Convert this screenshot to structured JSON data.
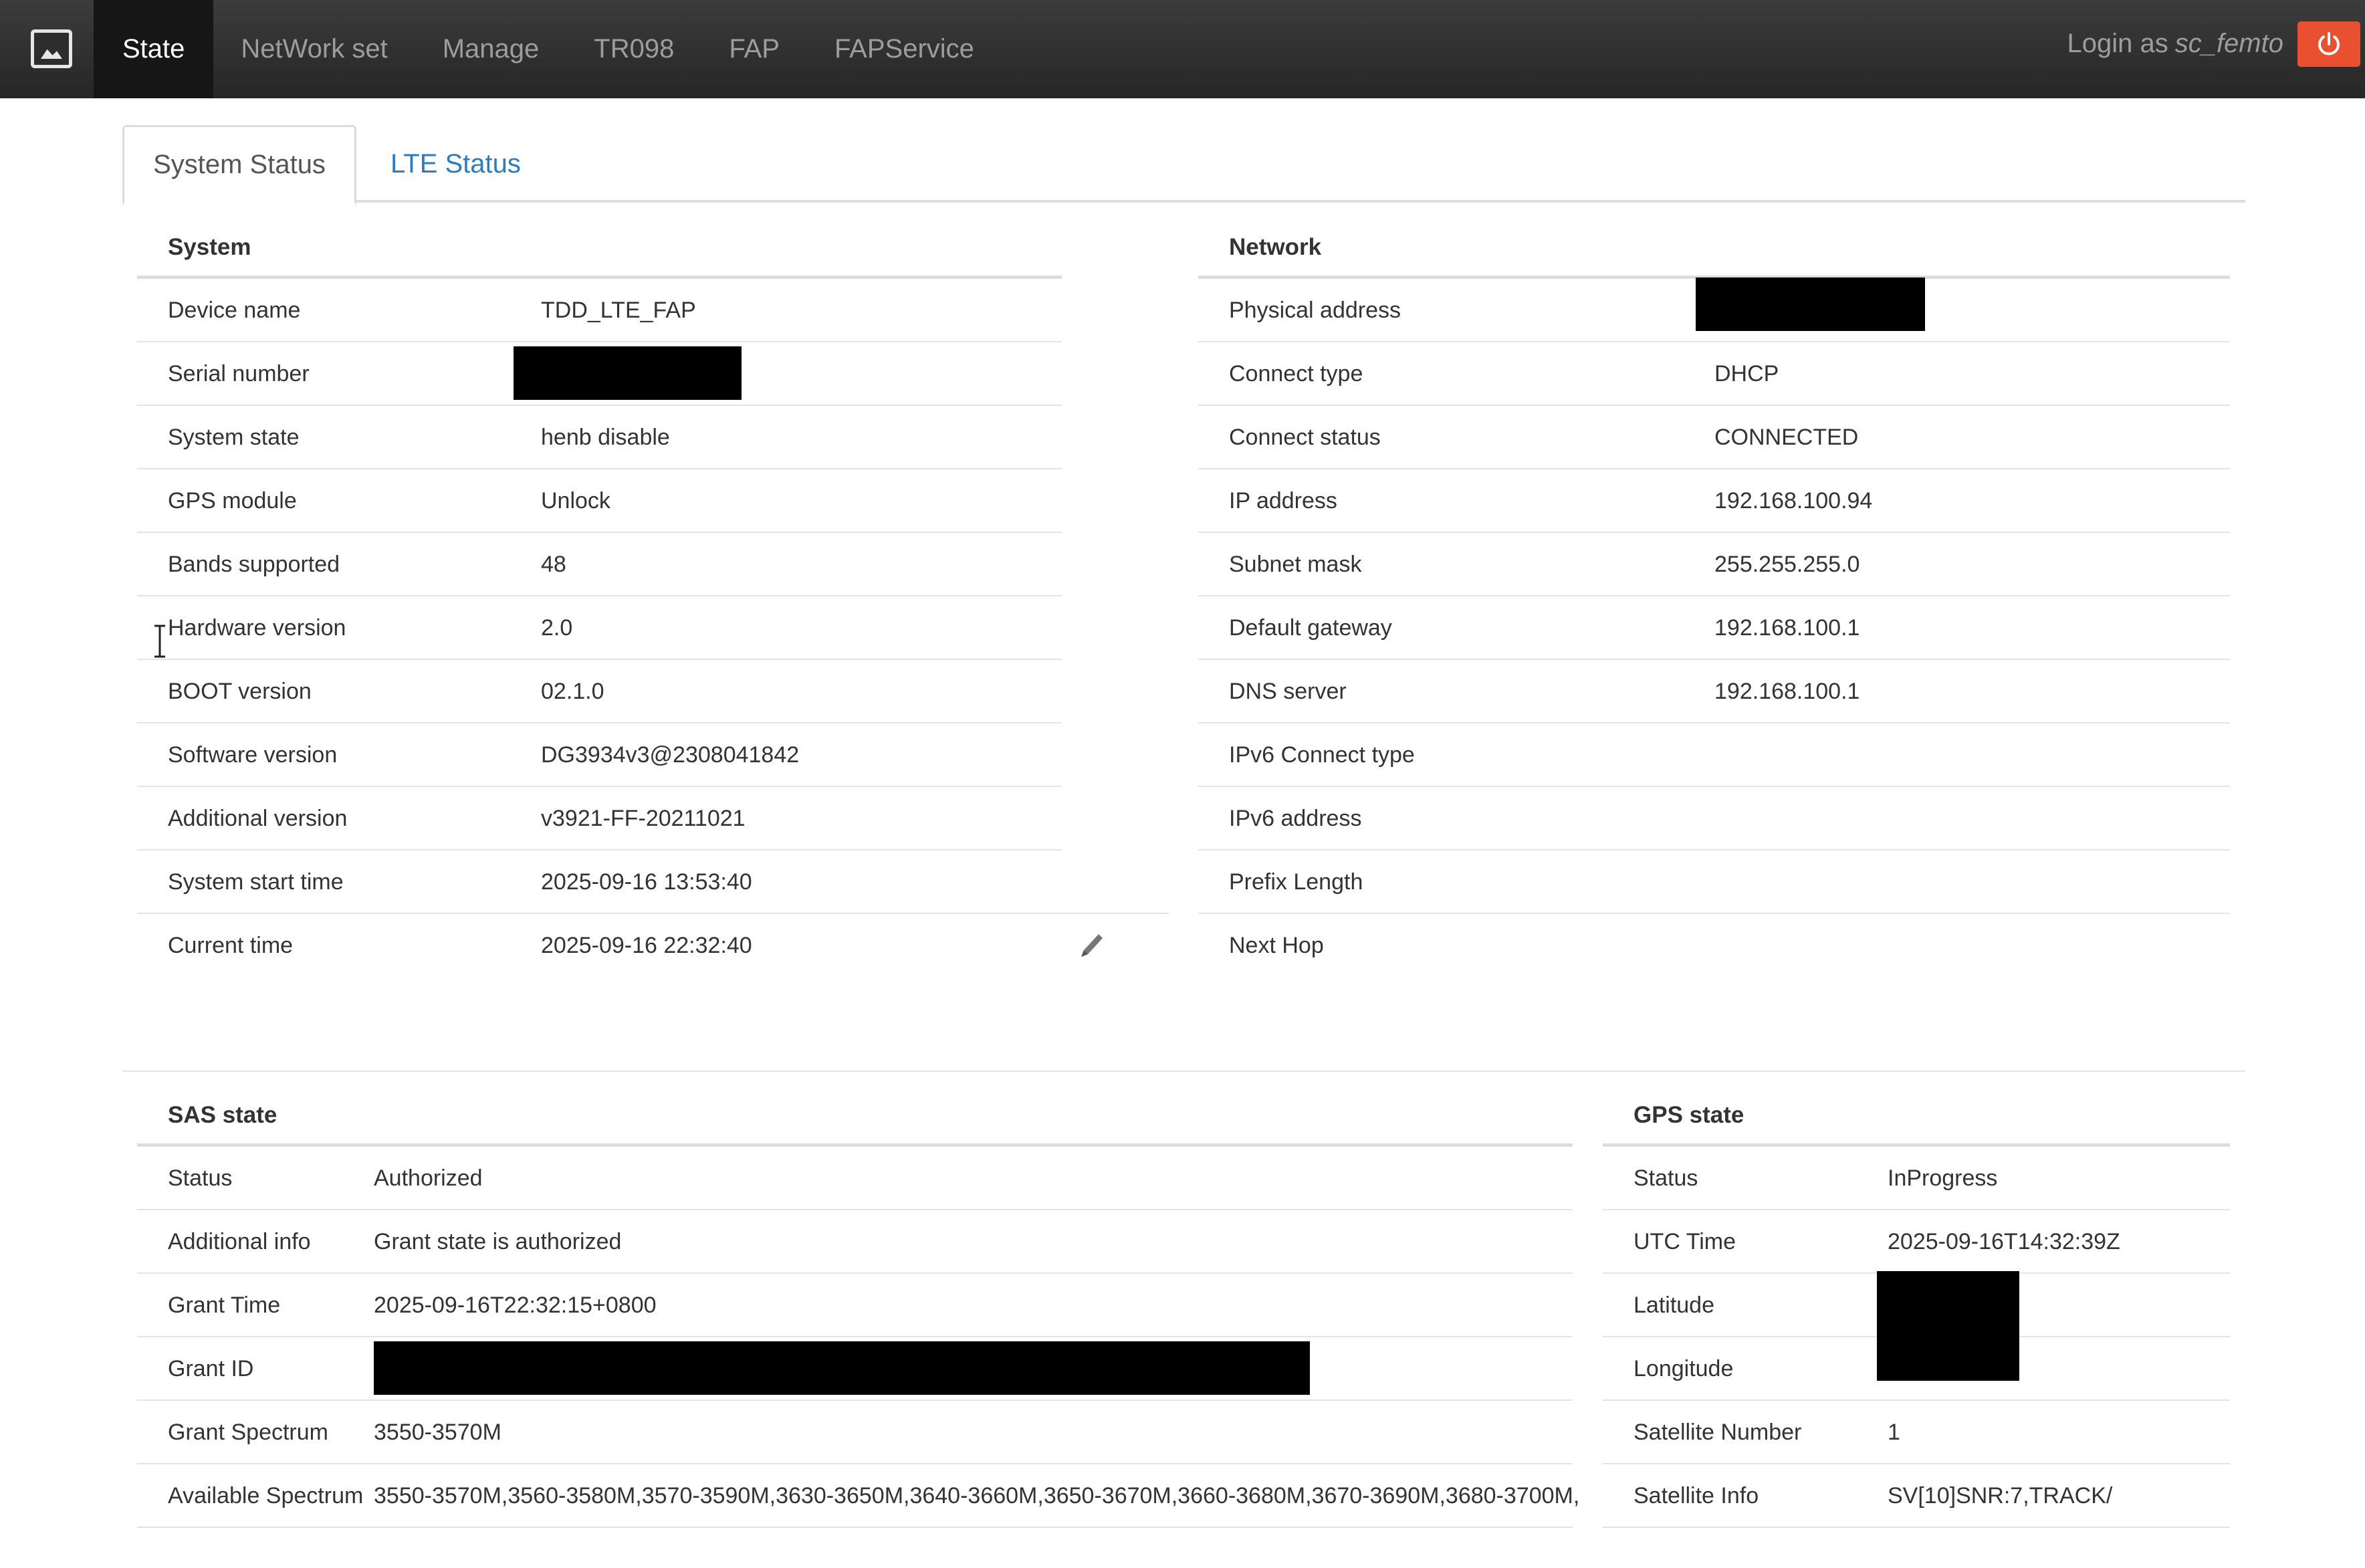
{
  "navbar": {
    "logo_icon": "device-logo-icon",
    "items": [
      "State",
      "NetWork set",
      "Manage",
      "TR098",
      "FAP",
      "FAPService"
    ],
    "active_index": 0,
    "login_label": "Login as",
    "login_user": "sc_femto",
    "power_icon": "power-icon",
    "power_color": "#e8502f"
  },
  "tabs": {
    "system_status": "System Status",
    "lte_status": "LTE Status"
  },
  "system": {
    "title": "System",
    "rows": [
      {
        "label": "Device name",
        "value": "TDD_LTE_FAP"
      },
      {
        "label": "Serial number",
        "value": ""
      },
      {
        "label": "System state",
        "value": "henb disable"
      },
      {
        "label": "GPS module",
        "value": "Unlock"
      },
      {
        "label": "Bands supported",
        "value": "48"
      },
      {
        "label": "Hardware version",
        "value": "2.0"
      },
      {
        "label": "BOOT version",
        "value": "02.1.0"
      },
      {
        "label": "Software version",
        "value": "DG3934v3@2308041842"
      },
      {
        "label": "Additional version",
        "value": "v3921-FF-20211021"
      },
      {
        "label": "System start time",
        "value": "2025-09-16 13:53:40"
      },
      {
        "label": "Current time",
        "value": "2025-09-16 22:32:40"
      }
    ]
  },
  "network": {
    "title": "Network",
    "rows": [
      {
        "label": "Physical address",
        "value": ""
      },
      {
        "label": "Connect type",
        "value": "DHCP"
      },
      {
        "label": "Connect status",
        "value": "CONNECTED"
      },
      {
        "label": "IP address",
        "value": "192.168.100.94"
      },
      {
        "label": "Subnet mask",
        "value": "255.255.255.0"
      },
      {
        "label": "Default gateway",
        "value": "192.168.100.1"
      },
      {
        "label": "DNS server",
        "value": "192.168.100.1"
      },
      {
        "label": "IPv6 Connect type",
        "value": ""
      },
      {
        "label": "IPv6 address",
        "value": ""
      },
      {
        "label": "Prefix Length",
        "value": ""
      },
      {
        "label": "Next Hop",
        "value": ""
      }
    ]
  },
  "sas": {
    "title": "SAS state",
    "rows": [
      {
        "label": "Status",
        "value": "Authorized"
      },
      {
        "label": "Additional info",
        "value": "Grant state is authorized"
      },
      {
        "label": "Grant Time",
        "value": "2025-09-16T22:32:15+0800"
      },
      {
        "label": "Grant ID",
        "value": ""
      },
      {
        "label": "Grant Spectrum",
        "value": "3550-3570M"
      },
      {
        "label": "Available Spectrum",
        "value": "3550-3570M,3560-3580M,3570-3590M,3630-3650M,3640-3660M,3650-3670M,3660-3680M,3670-3690M,3680-3700M,"
      }
    ]
  },
  "gps": {
    "title": "GPS state",
    "rows": [
      {
        "label": "Status",
        "value": "InProgress"
      },
      {
        "label": "UTC Time",
        "value": "2025-09-16T14:32:39Z"
      },
      {
        "label": "Latitude",
        "value": ""
      },
      {
        "label": "Longitude",
        "value": ""
      },
      {
        "label": "Satellite Number",
        "value": "1"
      },
      {
        "label": "Satellite Info",
        "value": "SV[10]SNR:7,TRACK/"
      }
    ]
  },
  "icons": {
    "edit_time": "pencil-icon",
    "text_cursor": "text-cursor-icon"
  }
}
